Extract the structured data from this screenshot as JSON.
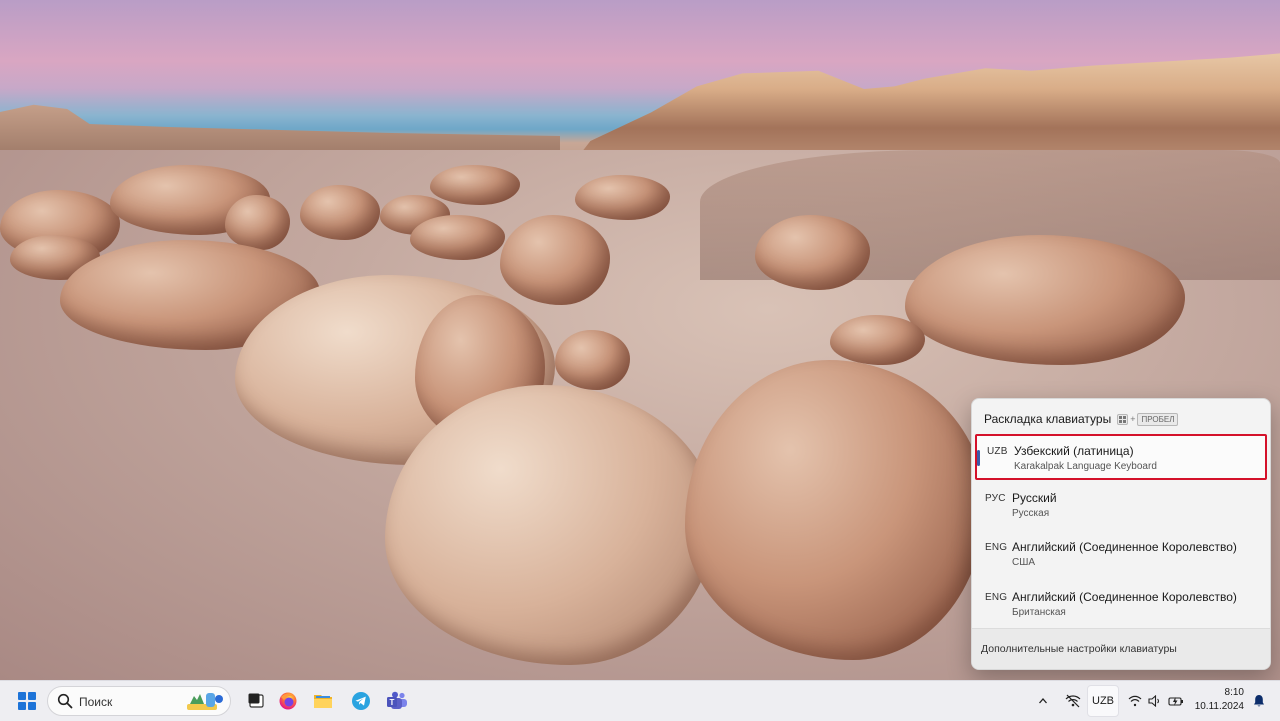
{
  "flyout": {
    "title": "Раскладка клавиатуры",
    "shortcut_plus": "+",
    "shortcut_key": "ПРОБЕЛ",
    "items": [
      {
        "code": "UZB",
        "name": "Узбекский (латиница)",
        "sub": "Karakalpak Language Keyboard",
        "selected": true
      },
      {
        "code": "РУС",
        "name": "Русский",
        "sub": "Русская",
        "selected": false
      },
      {
        "code": "ENG",
        "name": "Английский (Соединенное Королевство)",
        "sub": "США",
        "selected": false
      },
      {
        "code": "ENG",
        "name": "Английский (Соединенное Королевство)",
        "sub": "Британская",
        "selected": false
      }
    ],
    "footer": "Дополнительные настройки клавиатуры"
  },
  "taskbar": {
    "search_placeholder": "Поиск",
    "pinned": [
      "file-explorer-icon",
      "firefox-icon",
      "folder-icon",
      "telegram-icon",
      "teams-icon"
    ],
    "tray": {
      "language": "UZB",
      "time": "8:10",
      "date": "10.11.2024"
    }
  },
  "colors": {
    "selection_outline": "#d4112a",
    "selected_indicator": "#3c5aa8",
    "start_blue": "#1d73d8"
  }
}
